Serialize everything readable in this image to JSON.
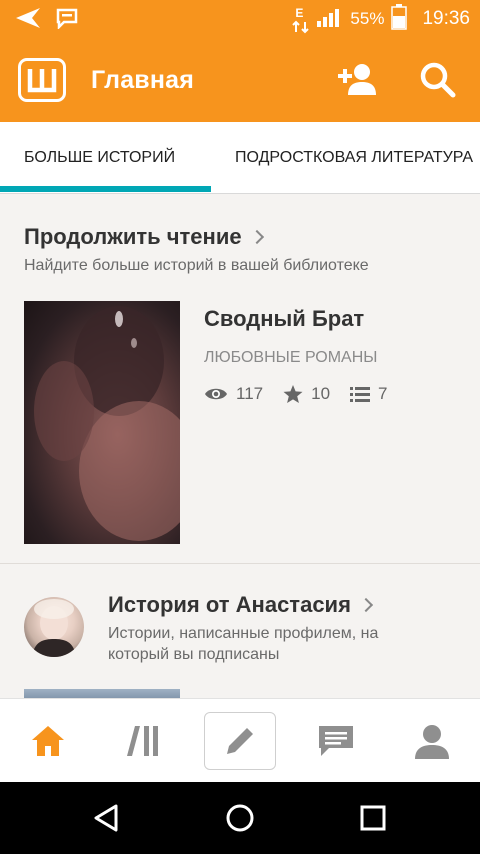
{
  "status_bar": {
    "battery_percent": "55%",
    "time": "19:36",
    "network_label": "E"
  },
  "header": {
    "title": "Главная",
    "logo_letter": "Ш"
  },
  "tabs": [
    {
      "label": "БОЛЬШЕ ИСТОРИЙ",
      "selected": true
    },
    {
      "label": "ПОДРОСТКОВАЯ ЛИТЕРАТУРА",
      "selected": false
    }
  ],
  "continue_reading": {
    "title": "Продолжить чтение",
    "subtitle": "Найдите больше историй в вашей библиотеке",
    "story": {
      "title": "Сводный Брат",
      "genre": "ЛЮБОВНЫЕ РОМАНЫ",
      "views": "117",
      "votes": "10",
      "parts": "7"
    }
  },
  "story_from": {
    "title": "История от Анастасия",
    "subtitle_line1": "Истории, написанные профилем, на",
    "subtitle_line2": "который вы подписаны"
  },
  "colors": {
    "accent_orange": "#f7941d",
    "tab_underline": "#00a7b5",
    "home_active": "#f7941d",
    "nav_inactive": "#8f8f8f"
  },
  "bottom_nav": [
    "home-icon",
    "library-icon",
    "write-icon",
    "messages-icon",
    "profile-icon"
  ]
}
